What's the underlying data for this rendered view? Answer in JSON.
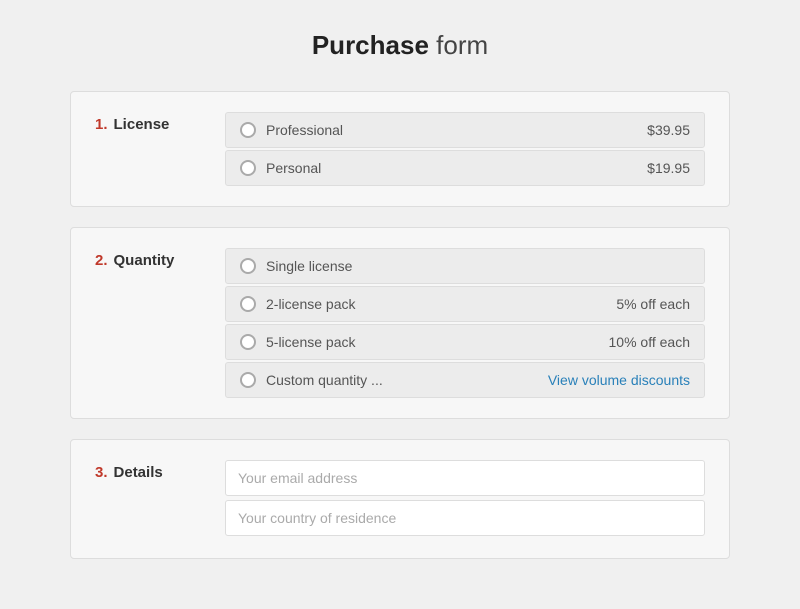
{
  "page": {
    "title_bold": "Purchase",
    "title_normal": " form"
  },
  "sections": {
    "license": {
      "number": "1.",
      "label": "License",
      "options": [
        {
          "id": "professional",
          "label": "Professional",
          "value": "$39.95",
          "value_type": "price"
        },
        {
          "id": "personal",
          "label": "Personal",
          "value": "$19.95",
          "value_type": "price"
        }
      ]
    },
    "quantity": {
      "number": "2.",
      "label": "Quantity",
      "options": [
        {
          "id": "single",
          "label": "Single license",
          "value": "",
          "value_type": "none"
        },
        {
          "id": "two-pack",
          "label": "2-license pack",
          "value": "5% off each",
          "value_type": "discount"
        },
        {
          "id": "five-pack",
          "label": "5-license pack",
          "value": "10% off each",
          "value_type": "discount"
        },
        {
          "id": "custom",
          "label": "Custom quantity ...",
          "value": "View volume discounts",
          "value_type": "link"
        }
      ]
    },
    "details": {
      "number": "3.",
      "label": "Details",
      "fields": [
        {
          "id": "email",
          "placeholder": "Your email address"
        },
        {
          "id": "country",
          "placeholder": "Your country of residence"
        }
      ]
    }
  }
}
